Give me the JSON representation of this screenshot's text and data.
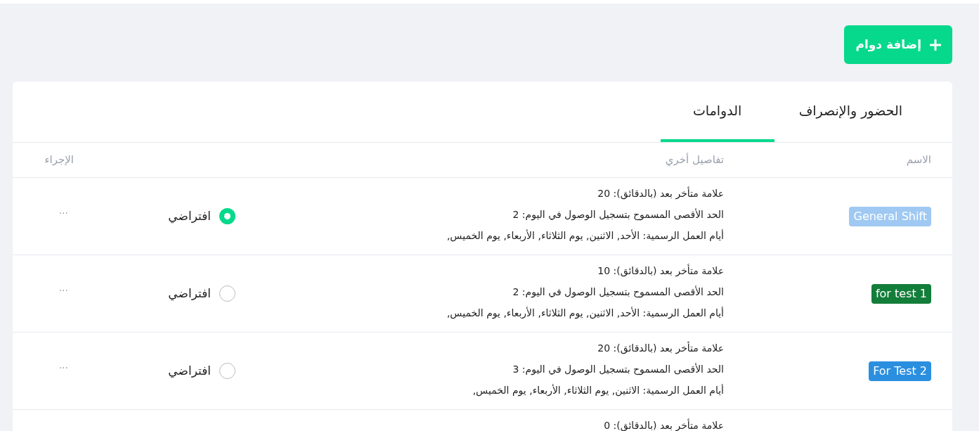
{
  "add_button": {
    "label": "إضافة دوام"
  },
  "tabs": [
    {
      "label": "الحضور والإنصراف",
      "selected": false
    },
    {
      "label": "الدوامات",
      "selected": true
    }
  ],
  "table": {
    "columns": [
      "الاسم",
      "تفاصيل أخري",
      "",
      "الإجراء"
    ],
    "rows": [
      {
        "name": "General Shift",
        "color": "#9fc9f2",
        "details": [
          "علامة متأخر بعد (بالدقائق): 20",
          "الحد الأقصى المسموح بتسجيل الوصول في اليوم: 2",
          "أيام العمل الرسمية: الأحد, الاثنين, يوم الثلاثاء, الأربعاء, يوم الخميس,"
        ],
        "default_label": "افتراضي",
        "selected": true,
        "action": "···"
      },
      {
        "name": "for test 1",
        "color": "#137d3a",
        "details": [
          "علامة متأخر بعد (بالدقائق): 10",
          "الحد الأقصى المسموح بتسجيل الوصول في اليوم: 2",
          "أيام العمل الرسمية: الأحد, الاثنين, يوم الثلاثاء, الأربعاء, يوم الخميس,"
        ],
        "default_label": "افتراضي",
        "selected": false,
        "action": "···"
      },
      {
        "name": "For Test 2",
        "color": "#2b8fe0",
        "details": [
          "علامة متأخر بعد (بالدقائق): 20",
          "الحد الأقصى المسموح بتسجيل الوصول في اليوم: 3",
          "أيام العمل الرسمية: الاثنين, يوم الثلاثاء, الأربعاء, يوم الخميس,"
        ],
        "default_label": "افتراضي",
        "selected": false,
        "action": "···"
      },
      {
        "details": [
          "علامة متأخر بعد (بالدقائق): 0"
        ]
      }
    ]
  }
}
